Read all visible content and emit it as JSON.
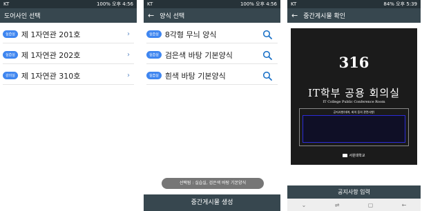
{
  "screen1": {
    "status": {
      "carrier": "KT",
      "right": "100% 오후 4:56"
    },
    "title": "도어사인 선택",
    "rooms": [
      {
        "badge": "실습실",
        "label": "제 1자연관 201호"
      },
      {
        "badge": "실습실",
        "label": "제 1자연관 202호"
      },
      {
        "badge": "강의실",
        "label": "제 1자연관 310호"
      }
    ]
  },
  "screen2": {
    "status": {
      "carrier": "KT",
      "right": "100% 오후 4:56"
    },
    "title": "양식 선택",
    "items": [
      {
        "badge": "실습실",
        "label": "8각형 무늬 양식"
      },
      {
        "badge": "실습실",
        "label": "검은색 바탕 기본양식"
      },
      {
        "badge": "실습실",
        "label": "흰색 바탕 기본양식"
      }
    ],
    "toast": "선택됨 : 실습실, 검은색 바탕 기본양식",
    "generate_button": "중간게시물 생성"
  },
  "screen3": {
    "status": {
      "carrier": "KT",
      "right": "84% 오후 5:39"
    },
    "title": "중간게시물 확인",
    "poster": {
      "room_number": "316",
      "room_name": "IT학부 공용 회의실",
      "room_name_en": "IT College Public Conference Room",
      "notice_title": "공지사항(대여, 회의 등의 관련사항)",
      "logo_text": "서원대학교"
    },
    "input_button": "공지사항 입력"
  },
  "colors": {
    "appbar": "#37474f",
    "statusbar": "#263238",
    "badge": "#3f86f0",
    "search_icon": "#1e73c8"
  }
}
